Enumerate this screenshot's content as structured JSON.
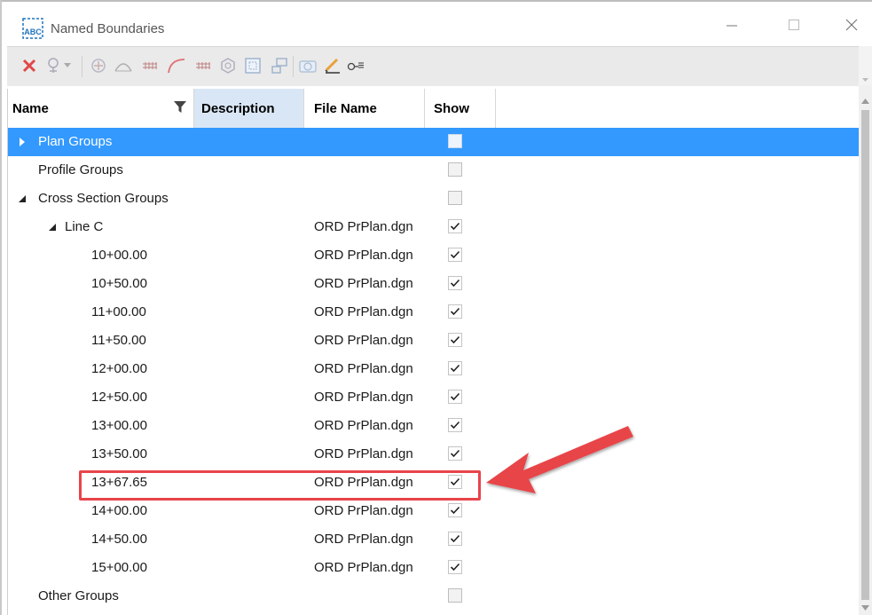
{
  "window": {
    "title": "Named Boundaries"
  },
  "columns": {
    "name": "Name",
    "description": "Description",
    "file_name": "File Name",
    "show": "Show"
  },
  "rows": [
    {
      "name": "Plan Groups",
      "file": "",
      "show": false,
      "selected": true,
      "level": 0,
      "expander": "collapsed"
    },
    {
      "name": "Profile Groups",
      "file": "",
      "show": false,
      "level": 0,
      "expander": "none"
    },
    {
      "name": "Cross Section Groups",
      "file": "",
      "show": false,
      "level": 0,
      "expander": "expanded"
    },
    {
      "name": "Line C",
      "file": "ORD PrPlan.dgn",
      "show": true,
      "level": 1,
      "expander": "expanded"
    },
    {
      "name": "10+00.00",
      "file": "ORD PrPlan.dgn",
      "show": true,
      "level": 2
    },
    {
      "name": "10+50.00",
      "file": "ORD PrPlan.dgn",
      "show": true,
      "level": 2
    },
    {
      "name": "11+00.00",
      "file": "ORD PrPlan.dgn",
      "show": true,
      "level": 2
    },
    {
      "name": "11+50.00",
      "file": "ORD PrPlan.dgn",
      "show": true,
      "level": 2
    },
    {
      "name": "12+00.00",
      "file": "ORD PrPlan.dgn",
      "show": true,
      "level": 2
    },
    {
      "name": "12+50.00",
      "file": "ORD PrPlan.dgn",
      "show": true,
      "level": 2
    },
    {
      "name": "13+00.00",
      "file": "ORD PrPlan.dgn",
      "show": true,
      "level": 2
    },
    {
      "name": "13+50.00",
      "file": "ORD PrPlan.dgn",
      "show": true,
      "level": 2
    },
    {
      "name": "13+67.65",
      "file": "ORD PrPlan.dgn",
      "show": true,
      "level": 2,
      "highlighted": true
    },
    {
      "name": "14+00.00",
      "file": "ORD PrPlan.dgn",
      "show": true,
      "level": 2
    },
    {
      "name": "14+50.00",
      "file": "ORD PrPlan.dgn",
      "show": true,
      "level": 2
    },
    {
      "name": "15+00.00",
      "file": "ORD PrPlan.dgn",
      "show": true,
      "level": 2
    },
    {
      "name": "Other Groups",
      "file": "",
      "show": false,
      "level": 0,
      "expander": "none"
    }
  ],
  "toolbar_icons": [
    "delete-icon",
    "create-boundary-icon",
    "civil-boundary-icon",
    "profile-boundary-icon",
    "xs-grid-icon",
    "curve-boundary-icon",
    "xs-grid-2-icon",
    "3d-boundary-icon",
    "fence-boundary-icon",
    "drawing-boundary-icon",
    "camera-icon",
    "edit-pen-icon",
    "key-filter-icon"
  ],
  "colors": {
    "selection": "#3399ff",
    "annotation": "#e8444a",
    "accent_icon": "#1e73be"
  }
}
